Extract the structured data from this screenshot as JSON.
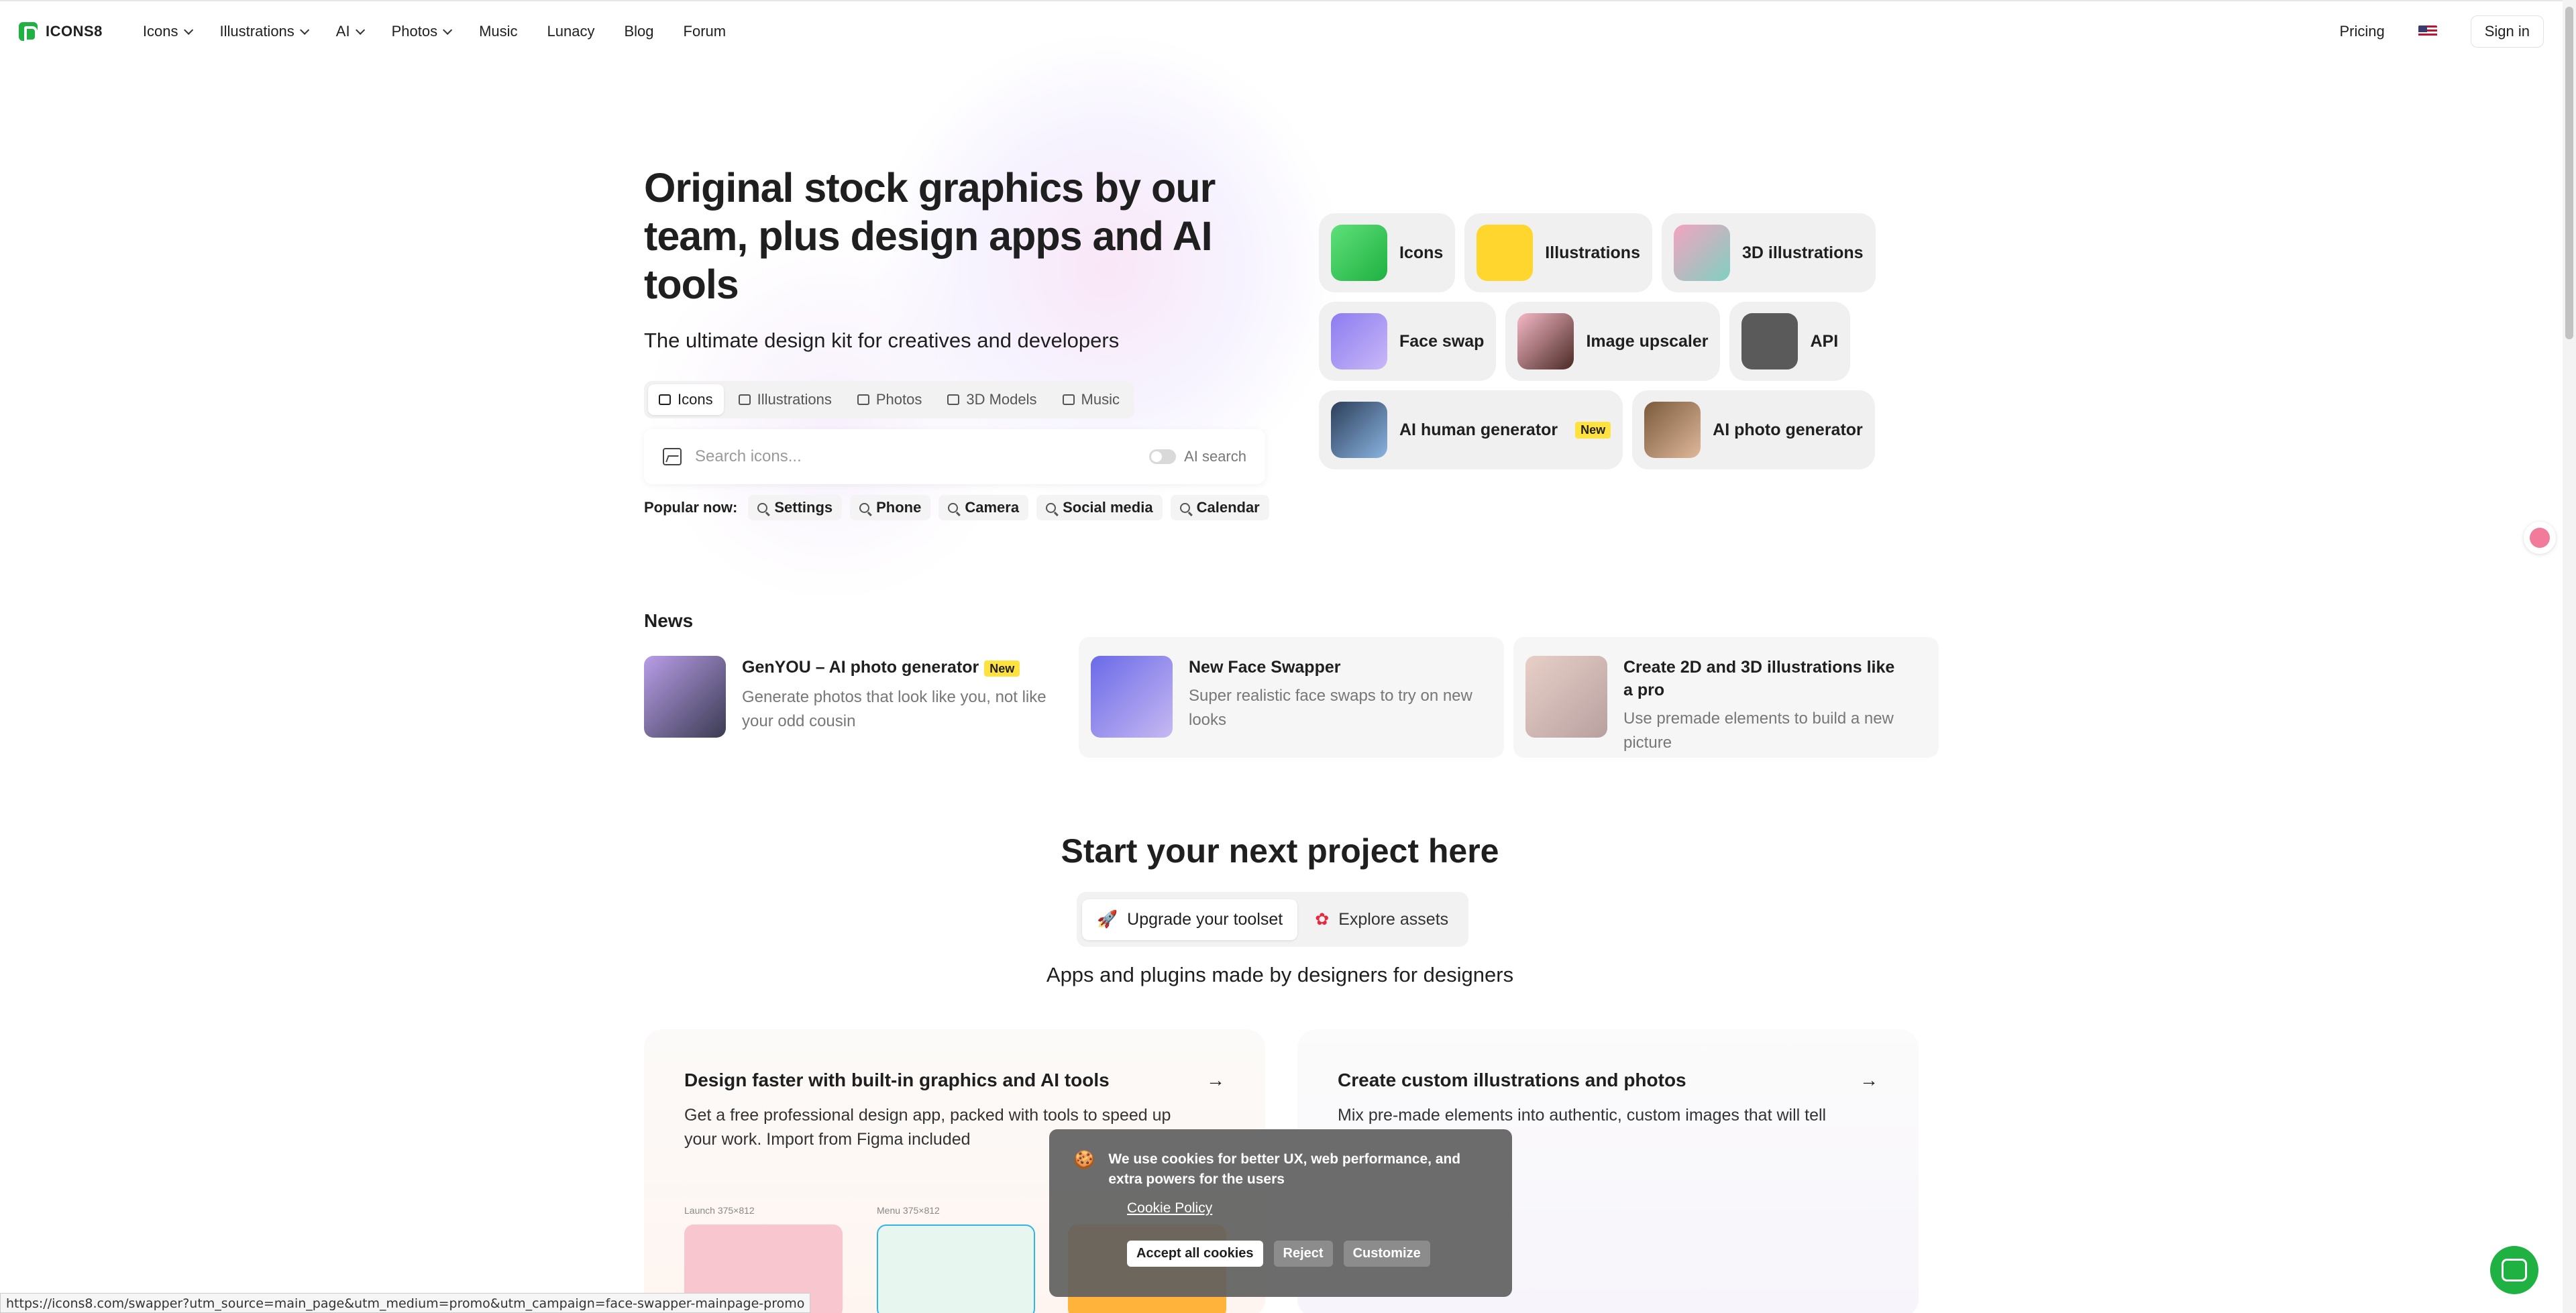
{
  "nav": {
    "logo": "ICONS8",
    "items": [
      "Icons",
      "Illustrations",
      "AI",
      "Photos",
      "Music",
      "Lunacy",
      "Blog",
      "Forum"
    ],
    "pricing": "Pricing",
    "signin": "Sign in"
  },
  "hero": {
    "title": "Original stock graphics by our team, plus design apps and AI tools",
    "subtitle": "The ultimate design kit for creatives and developers",
    "tabs": [
      "Icons",
      "Illustrations",
      "Photos",
      "3D Models",
      "Music"
    ],
    "search_placeholder": "Search icons...",
    "ai_search": "AI search",
    "popular_label": "Popular now:",
    "popular": [
      "Settings",
      "Phone",
      "Camera",
      "Social media",
      "Calendar"
    ]
  },
  "tiles": {
    "row1": [
      "Icons",
      "Illustrations",
      "3D illustrations"
    ],
    "row2": [
      "Face swap",
      "Image upscaler",
      "API"
    ],
    "row3": [
      "AI human generator",
      "AI photo generator"
    ],
    "new_badge": "New"
  },
  "news": {
    "heading": "News",
    "items": [
      {
        "title": "GenYOU – AI photo generator",
        "desc": "Generate photos that look like you, not like your odd cousin"
      },
      {
        "title": "New Face Swapper",
        "desc": "Super realistic face swaps to try on new looks"
      },
      {
        "title": "Create 2D and 3D illustrations like a pro",
        "desc": "Use premade elements to build a new picture"
      }
    ]
  },
  "start": {
    "heading": "Start your next project here",
    "seg_upgrade": "Upgrade your toolset",
    "seg_explore": "Explore assets",
    "subtitle": "Apps and plugins made by designers for designers",
    "feature_left": {
      "title": "Design faster with built-in graphics and AI tools",
      "desc": "Get a free professional design app, packed with tools to speed up your work. Import from Figma included"
    },
    "feature_right": {
      "title": "Create custom illustrations and photos",
      "desc": "Mix pre-made elements into authentic, custom images that will tell"
    },
    "phone_labels": [
      "Launch 375×812",
      "Menu 375×812"
    ]
  },
  "cookie": {
    "text": "We use cookies for better UX, web performance, and extra powers for the users",
    "policy": "Cookie Policy",
    "accept": "Accept all cookies",
    "reject": "Reject",
    "customize": "Customize"
  },
  "status_url": "https://icons8.com/swapper?utm_source=main_page&utm_medium=promo&utm_campaign=face-swapper-mainpage-promo",
  "colors": {
    "brand": "#1fb141",
    "badge": "#ffe23d"
  }
}
